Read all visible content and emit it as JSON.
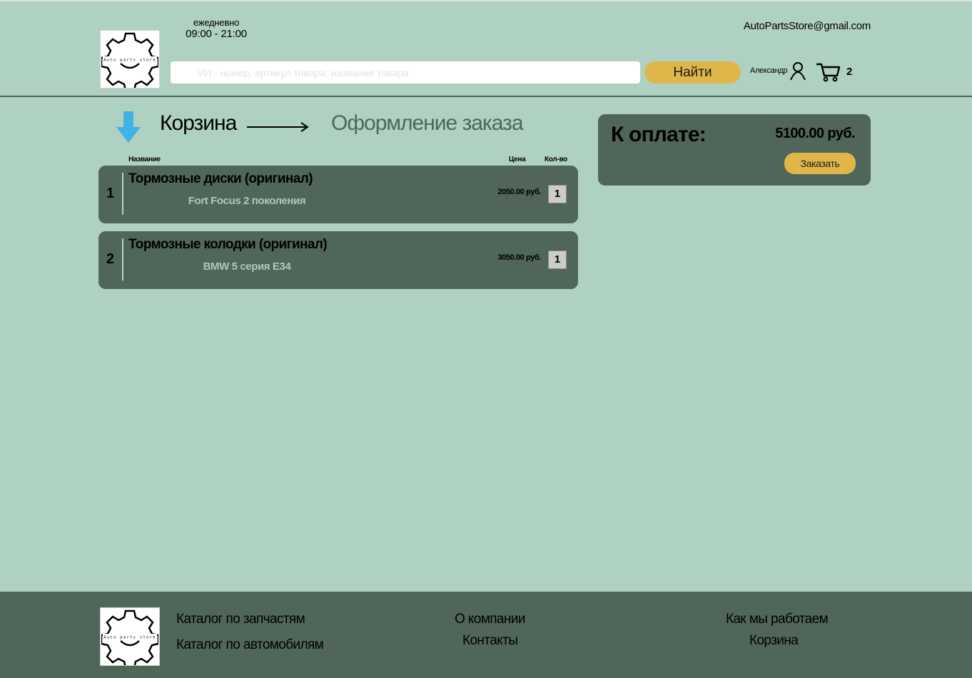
{
  "header": {
    "logo_text": "Auto parts store",
    "hours_label": "ежедневно",
    "hours_time": "09:00 - 21:00",
    "email": "AutoPartsStore@gmail.com",
    "search_placeholder": "Vin - номер, артикул товара, название товара",
    "search_button": "Найти",
    "user_name": "Александр",
    "cart_count": "2"
  },
  "steps": {
    "current": "Корзина",
    "next": "Оформление заказа"
  },
  "table": {
    "col_name": "Название",
    "col_price": "Цена",
    "col_qty": "Кол-во"
  },
  "items": [
    {
      "num": "1",
      "title": "Тормозные диски (оригинал)",
      "model": "Fort Focus 2 поколения",
      "price": "2050.00 руб.",
      "qty": "1"
    },
    {
      "num": "2",
      "title": "Тормозные колодки (оригинал)",
      "model": "BMW 5 серия E34",
      "price": "3050.00 руб.",
      "qty": "1"
    }
  ],
  "summary": {
    "label": "К оплате:",
    "total": "5100.00 руб.",
    "order_button": "Заказать"
  },
  "footer": {
    "parts_catalog": "Каталог по запчастям",
    "cars_catalog": "Каталог по автомобилям",
    "about": "О компании",
    "contacts": "Контакты",
    "how_we_work": "Как мы работаем",
    "cart": "Корзина"
  },
  "colors": {
    "background": "#afd1c2",
    "dark_panel": "#4f6659",
    "accent": "#dfb64a",
    "arrow": "#3fb3e3"
  },
  "icons": {
    "logo": "gear-logo-icon",
    "user": "user-icon",
    "cart": "cart-icon",
    "step": "arrow-down-icon"
  }
}
